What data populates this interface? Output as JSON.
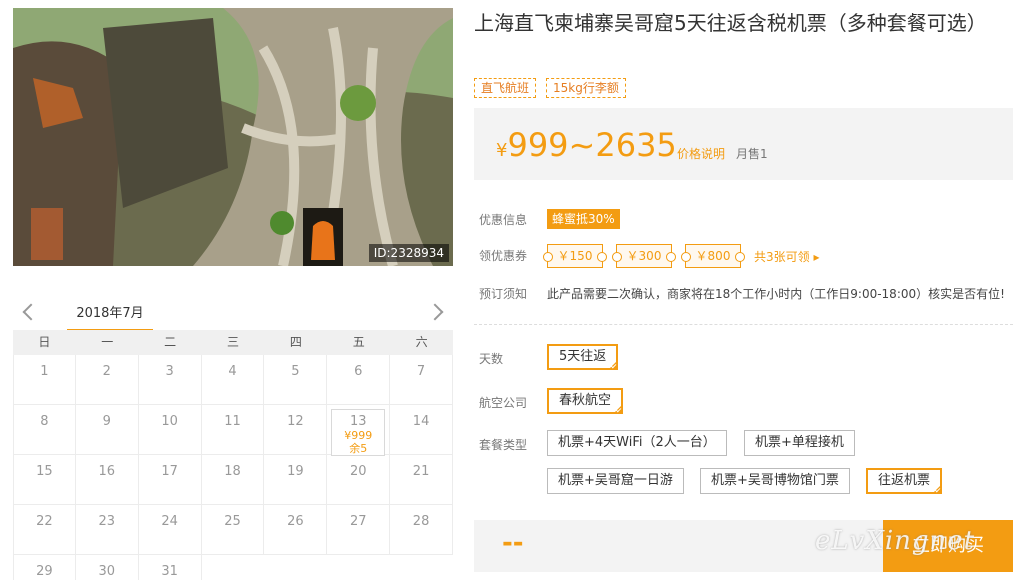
{
  "photo": {
    "id_label": "ID:2328934"
  },
  "calendar": {
    "month_label": "2018年7月",
    "weekdays": [
      "日",
      "一",
      "二",
      "三",
      "四",
      "五",
      "六"
    ],
    "days": [
      "1",
      "2",
      "3",
      "4",
      "5",
      "6",
      "7",
      "8",
      "9",
      "10",
      "11",
      "12",
      "13",
      "14",
      "15",
      "16",
      "17",
      "18",
      "19",
      "20",
      "21",
      "22",
      "23",
      "24",
      "25",
      "26",
      "27",
      "28",
      "29",
      "30",
      "31"
    ],
    "available": {
      "day": "13",
      "price": "¥999",
      "remaining": "余5"
    }
  },
  "product": {
    "title": "上海直飞柬埔寨吴哥窟5天往返含税机票（多种套餐可选）",
    "tags": [
      "直飞航班",
      "15kg行李额"
    ],
    "price": {
      "currency": "¥",
      "range": "999~2635",
      "explain_link": "价格说明",
      "monthly_sales": "月售1"
    }
  },
  "promo": {
    "info_label": "优惠信息",
    "info_badge": "蜂蜜抵30%",
    "coupon_label": "领优惠券",
    "coupons": [
      "￥150",
      "￥300",
      "￥800"
    ],
    "coupon_more": "共3张可领 ▸",
    "notice_label": "预订须知",
    "notice_text": "此产品需要二次确认，商家将在18个工作小时内（工作日9:00-18:00）核实是否有位!"
  },
  "options": {
    "days_label": "天数",
    "days_value": "5天往返",
    "airline_label": "航空公司",
    "airline_value": "春秋航空",
    "package_label": "套餐类型",
    "packages": [
      "机票+4天WiFi（2人一台）",
      "机票+单程接机",
      "机票+吴哥窟一日游",
      "机票+吴哥博物馆门票",
      "往返机票"
    ]
  },
  "buy": {
    "total": "--",
    "button": "立即购买"
  },
  "watermark": "eLvXingnet",
  "colors": {
    "accent": "#f39c12"
  }
}
